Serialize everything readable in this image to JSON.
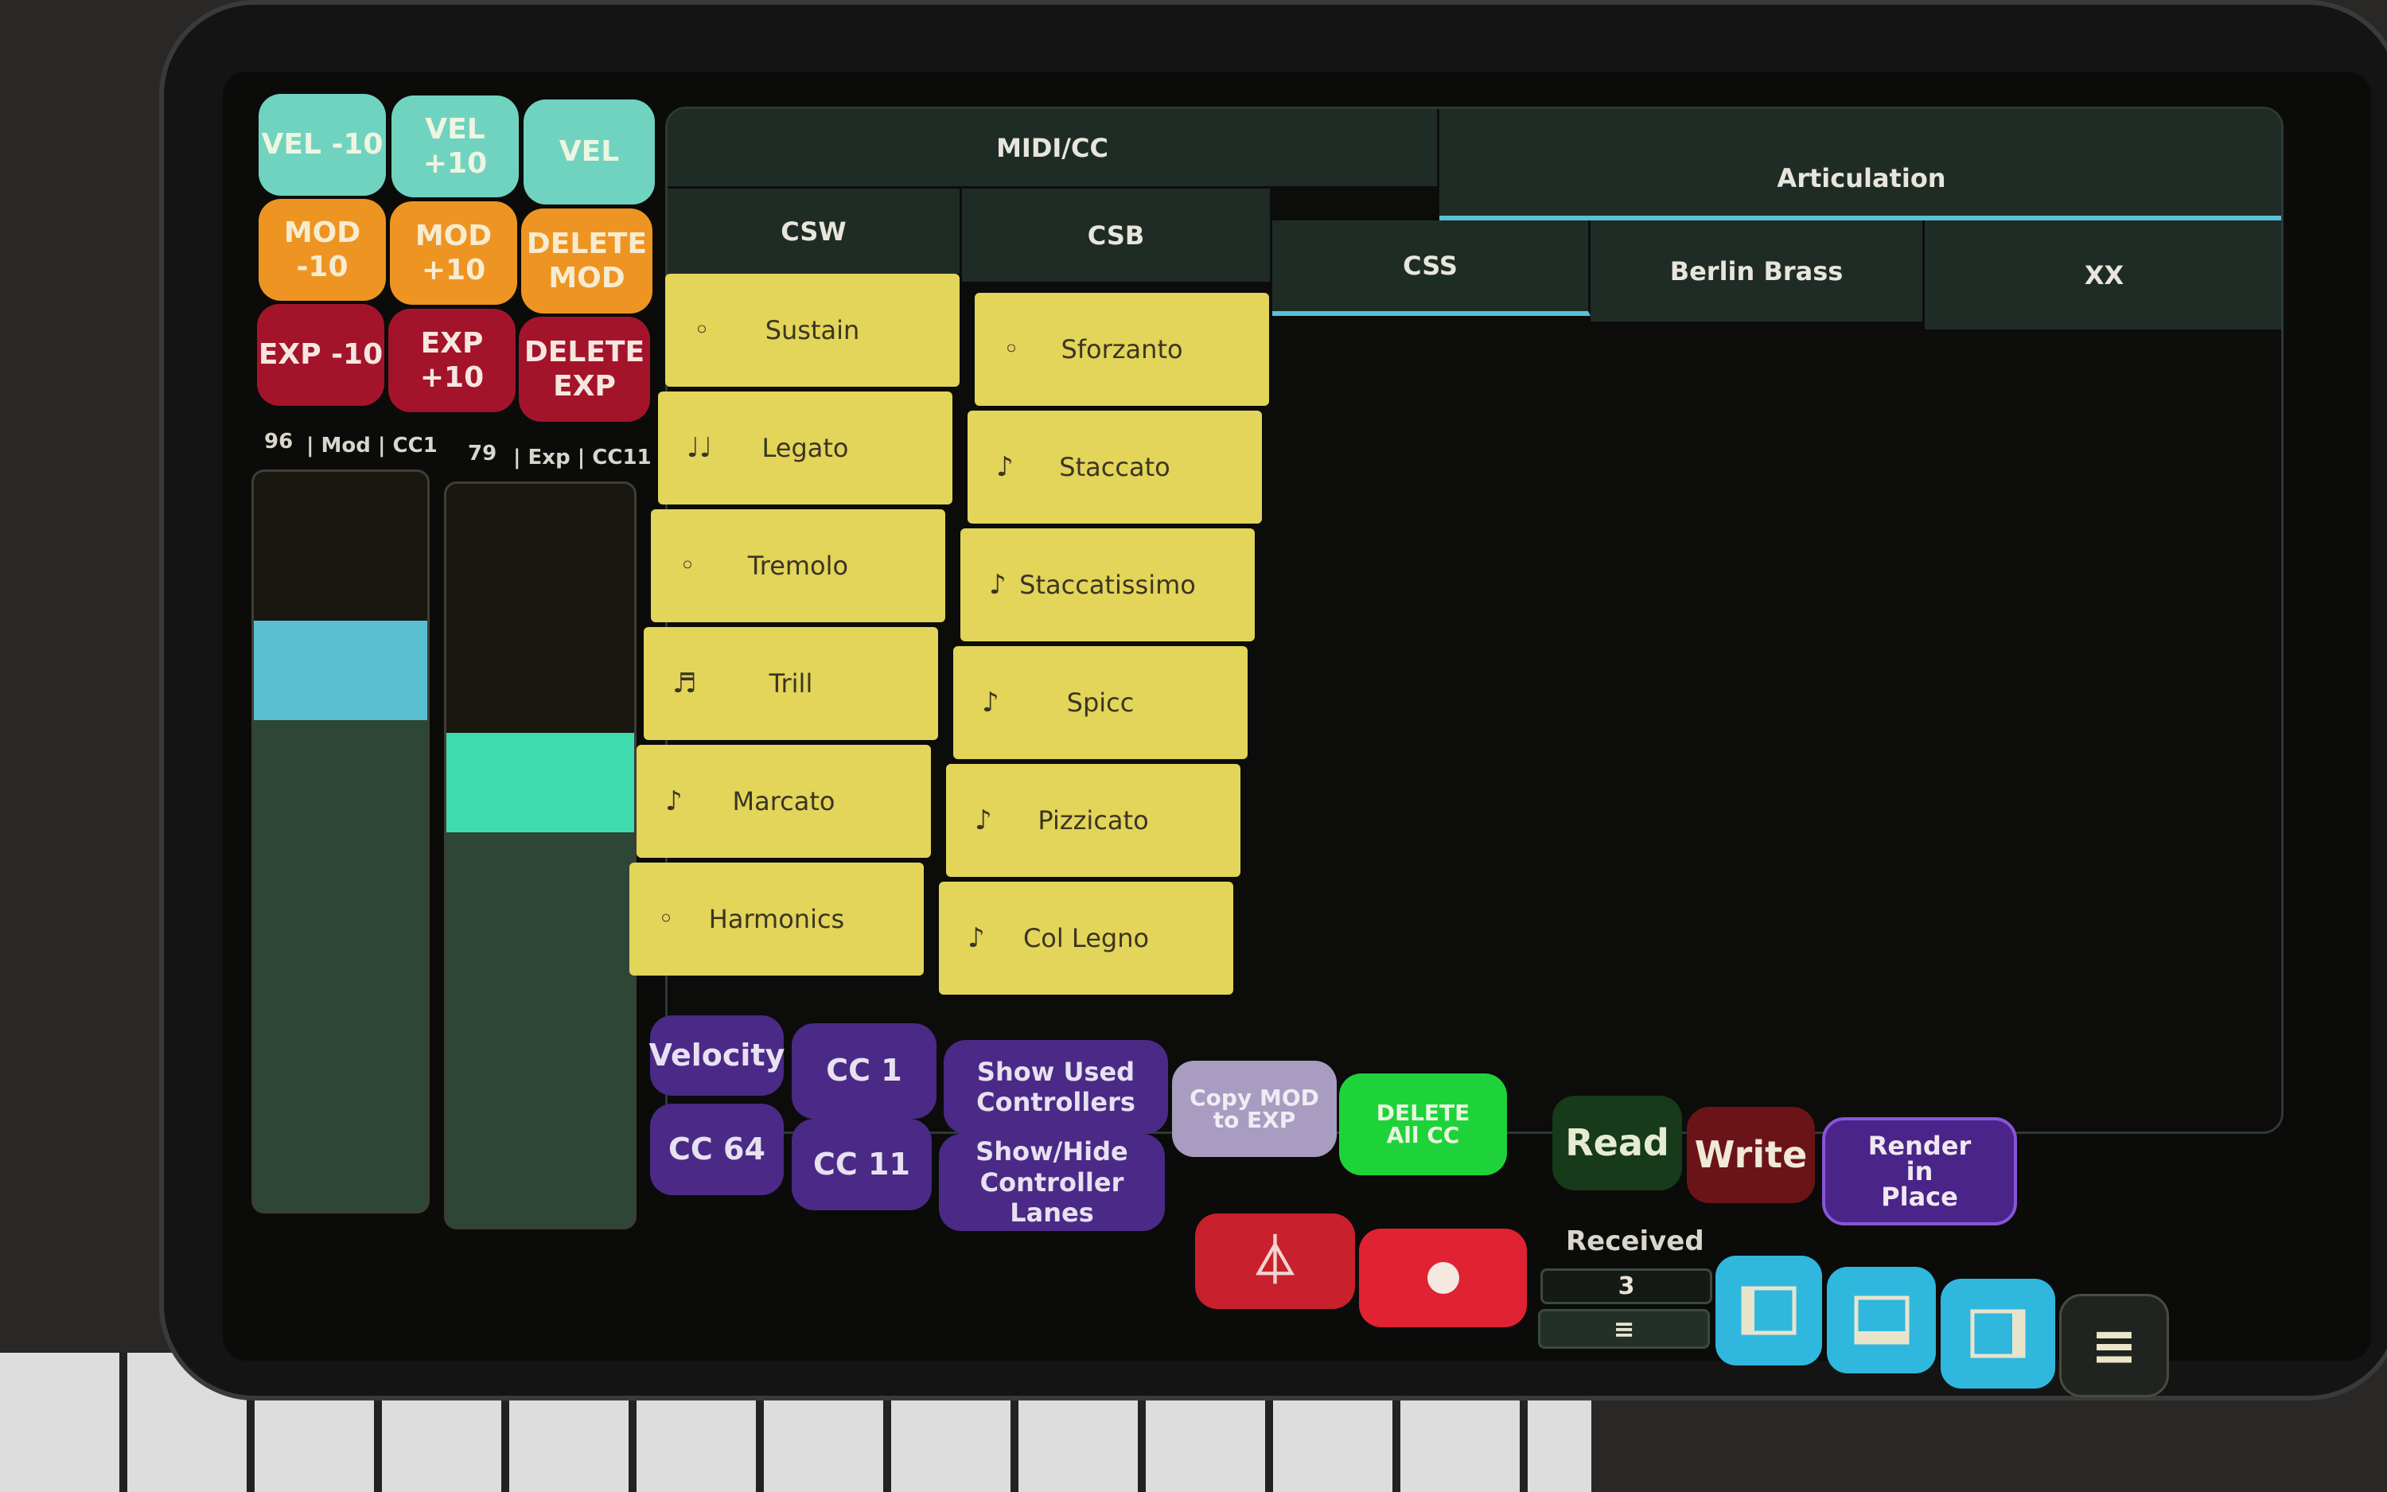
{
  "left_buttons": {
    "vel": [
      "VEL -10",
      "VEL +10",
      "VEL"
    ],
    "mod": [
      "MOD -10",
      "MOD +10",
      "DELETE MOD"
    ],
    "exp": [
      "EXP -10",
      "EXP +10",
      "DELETE EXP"
    ]
  },
  "sliders": [
    {
      "value": "96",
      "label": "| Mod | CC1",
      "level": 96,
      "max": 127,
      "color": "#5bbfd3"
    },
    {
      "value": "79",
      "label": "| Exp | CC11",
      "level": 79,
      "max": 127,
      "color": "#3fdcb0"
    }
  ],
  "tabs_top": [
    {
      "label": "MIDI/CC",
      "active": false
    },
    {
      "label": "Articulation",
      "active": true
    }
  ],
  "tabs_sub": [
    {
      "label": "CSW",
      "active": false
    },
    {
      "label": "CSB",
      "active": false
    },
    {
      "label": "CSS",
      "active": true
    },
    {
      "label": "Berlin Brass",
      "active": false
    },
    {
      "label": "XX",
      "active": false
    }
  ],
  "articulations_col1": [
    {
      "icon": "◦",
      "label": "Sustain"
    },
    {
      "icon": "♩♩",
      "label": "Legato"
    },
    {
      "icon": "◦",
      "label": "Tremolo"
    },
    {
      "icon": "♬",
      "label": "Trill"
    },
    {
      "icon": "♪",
      "label": "Marcato"
    },
    {
      "icon": "◦",
      "label": "Harmonics"
    }
  ],
  "articulations_col2": [
    {
      "icon": "◦",
      "label": "Sforzanto"
    },
    {
      "icon": "♪",
      "label": "Staccato"
    },
    {
      "icon": "♪",
      "label": "Staccatissimo"
    },
    {
      "icon": "♪",
      "label": "Spicc"
    },
    {
      "icon": "♪",
      "label": "Pizzicato"
    },
    {
      "icon": "♪",
      "label": "Col Legno"
    }
  ],
  "bottom": {
    "velocity": "Velocity",
    "cc1": "CC 1",
    "show_used": "Show Used Controllers",
    "cc64": "CC 64",
    "cc11": "CC 11",
    "show_hide": "Show/Hide Controller Lanes",
    "copy_mod": "Copy MOD to EXP",
    "delete_all": "DELETE All CC",
    "read": "Read",
    "write": "Write",
    "render": "Render in Place",
    "received_label": "Received",
    "received_value": "3"
  },
  "colors": {
    "accent": "#58c1d6",
    "yellow": "#e3d45a",
    "purple": "#4a2a86",
    "green": "#1ed33a"
  }
}
